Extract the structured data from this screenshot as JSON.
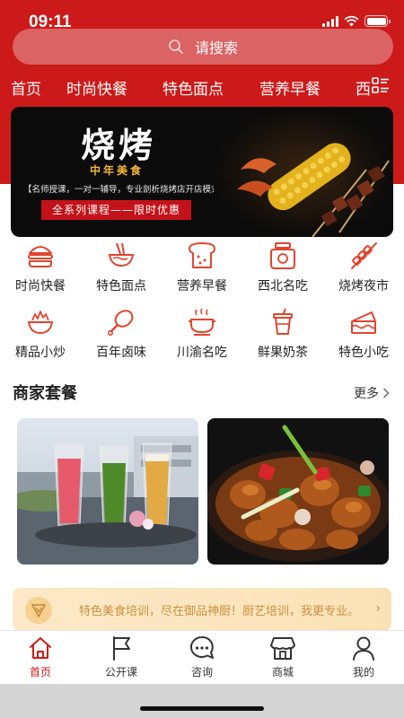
{
  "status_bar": {
    "time": "09:11"
  },
  "search": {
    "placeholder": "请搜索"
  },
  "category_nav": {
    "items": [
      "首页",
      "时尚快餐",
      "特色面点",
      "营养早餐",
      "西"
    ],
    "more_icon": "grid-list-icon"
  },
  "banner": {
    "title": "烧烤",
    "badge": "中年美食",
    "description": "【名师授课，一对一辅导，专业剖析烧烤店开店模式】",
    "promo": "全系列课程——限时优惠"
  },
  "categories": [
    {
      "label": "时尚快餐",
      "icon": "burger-icon"
    },
    {
      "label": "特色面点",
      "icon": "noodle-bowl-icon"
    },
    {
      "label": "营养早餐",
      "icon": "toast-icon"
    },
    {
      "label": "西北名吃",
      "icon": "jar-icon"
    },
    {
      "label": "烧烤夜市",
      "icon": "skewer-icon"
    },
    {
      "label": "精品小炒",
      "icon": "stir-fry-icon"
    },
    {
      "label": "百年卤味",
      "icon": "drumstick-icon"
    },
    {
      "label": "川渝名吃",
      "icon": "hotpot-icon"
    },
    {
      "label": "鲜果奶茶",
      "icon": "milk-tea-icon"
    },
    {
      "label": "特色小吃",
      "icon": "cake-icon"
    }
  ],
  "section": {
    "title": "商家套餐",
    "more": "更多"
  },
  "notice": {
    "text": "特色美食培训，尽在御品神厨！厨艺培训，我更专业。"
  },
  "tabbar": {
    "items": [
      {
        "label": "首页",
        "icon": "home-icon",
        "active": true
      },
      {
        "label": "公开课",
        "icon": "flag-icon",
        "active": false
      },
      {
        "label": "咨询",
        "icon": "chat-icon",
        "active": false
      },
      {
        "label": "商城",
        "icon": "store-icon",
        "active": false
      },
      {
        "label": "我的",
        "icon": "user-icon",
        "active": false
      }
    ]
  },
  "colors": {
    "brand_red": "#cc1a1a",
    "notice_text": "#c7913f",
    "icon_red": "#e0452f"
  }
}
